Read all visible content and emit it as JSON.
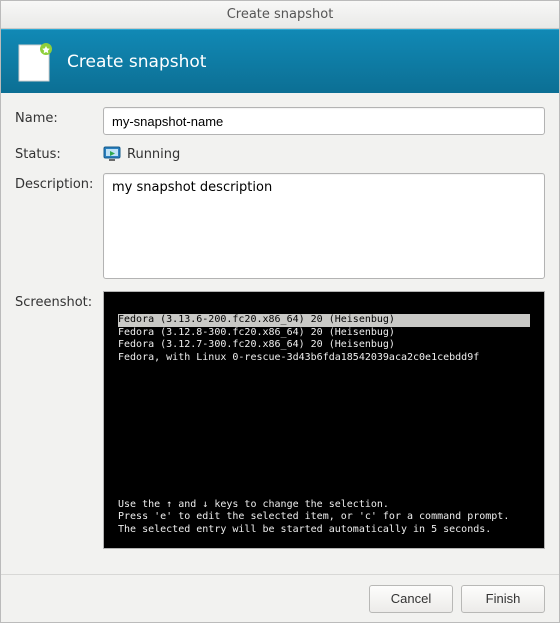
{
  "window": {
    "title": "Create snapshot"
  },
  "header": {
    "title": "Create snapshot"
  },
  "form": {
    "name_label": "Name:",
    "name_value": "my-snapshot-name",
    "status_label": "Status:",
    "status_value": "Running",
    "description_label": "Description:",
    "description_value": "my snapshot description",
    "screenshot_label": "Screenshot:"
  },
  "boot": {
    "entries": [
      "Fedora (3.13.6-200.fc20.x86_64) 20 (Heisenbug)",
      "Fedora (3.12.8-300.fc20.x86_64) 20 (Heisenbug)",
      "Fedora (3.12.7-300.fc20.x86_64) 20 (Heisenbug)",
      "Fedora, with Linux 0-rescue-3d43b6fda18542039aca2c0e1cebdd9f"
    ],
    "hint1": "Use the ↑ and ↓ keys to change the selection.",
    "hint2": "Press 'e' to edit the selected item, or 'c' for a command prompt.",
    "hint3": "The selected entry will be started automatically in 5 seconds."
  },
  "buttons": {
    "cancel": "Cancel",
    "finish": "Finish"
  }
}
